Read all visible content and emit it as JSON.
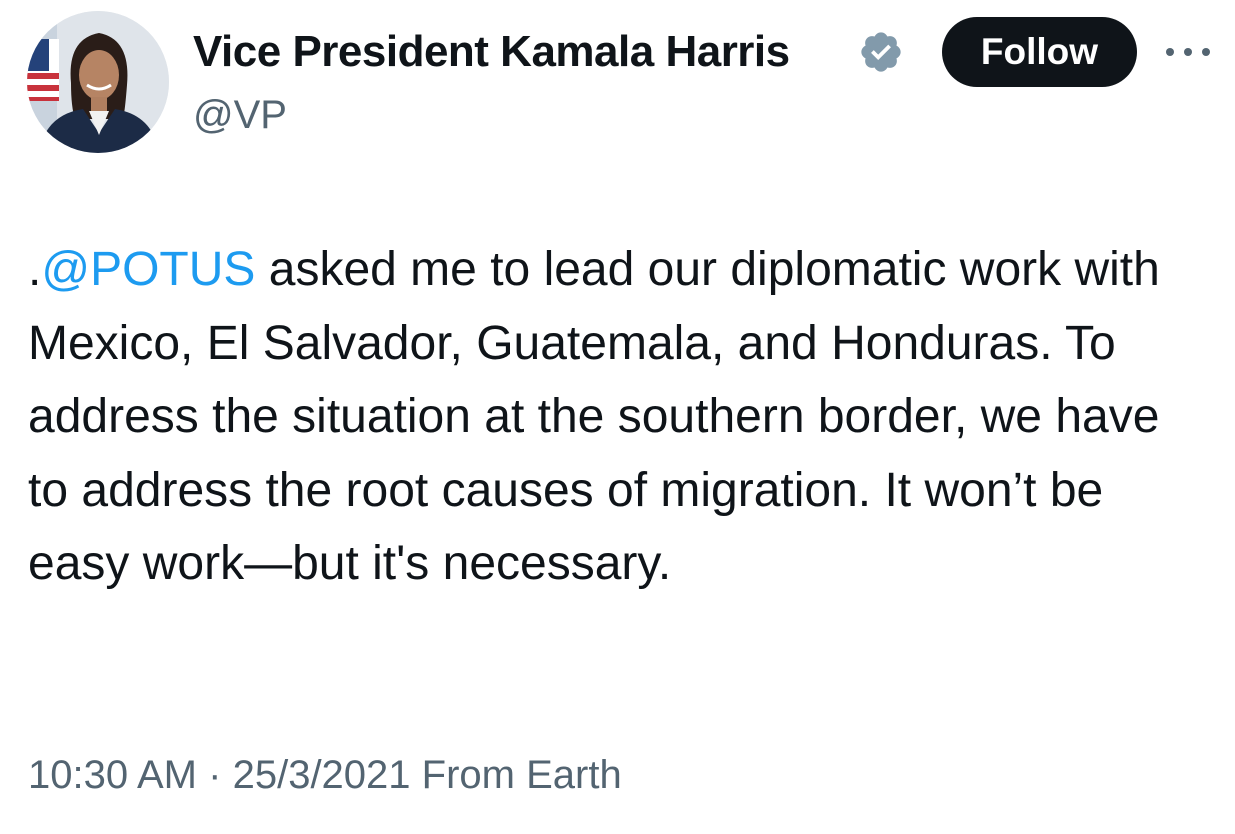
{
  "author": {
    "display_name": "Vice President Kamala Harris",
    "handle": "@VP",
    "verified_icon": "verified-badge-icon",
    "badge_color": "#829aab"
  },
  "actions": {
    "follow_label": "Follow",
    "more_icon": "more-options-icon"
  },
  "tweet": {
    "prefix": ".",
    "mention": "@POTUS",
    "text": " asked me to lead our diplomatic work with Mexico, El Salvador, Guatemala, and Honduras. To address the situation at the southern border, we have to address the root causes of migration. It won’t be easy work—but it's necessary."
  },
  "meta": {
    "time": "10:30 AM",
    "separator": "·",
    "date": "25/3/2021",
    "source": "From Earth"
  },
  "colors": {
    "text": "#0f1419",
    "secondary": "#536471",
    "link": "#1d9bf0",
    "button": "#0f1419"
  }
}
